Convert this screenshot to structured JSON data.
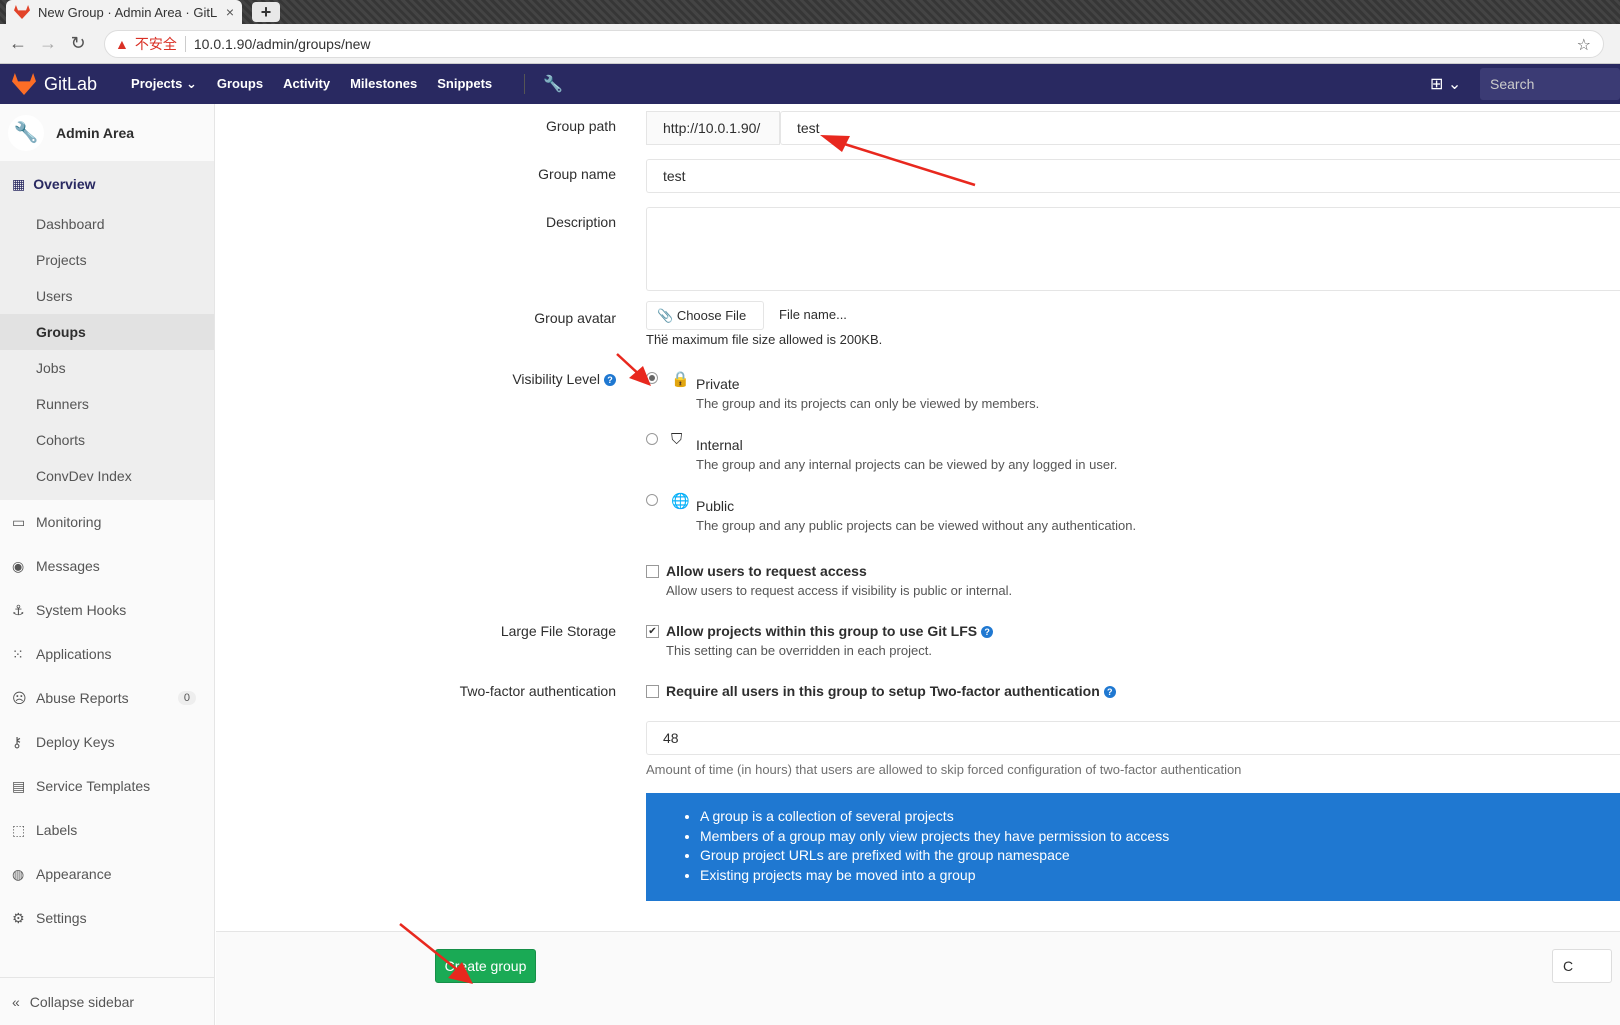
{
  "browser": {
    "tab_title": "New Group · Admin Area · GitL",
    "tab_close": "×",
    "new_tab": "+",
    "insecure_label": "不安全",
    "url": "10.0.1.90/admin/groups/new"
  },
  "topbar": {
    "brand": "GitLab",
    "nav": [
      "Projects",
      "Groups",
      "Activity",
      "Milestones",
      "Snippets"
    ],
    "search_placeholder": "Search"
  },
  "sidebar": {
    "title": "Admin Area",
    "overview": "Overview",
    "overview_items": [
      "Dashboard",
      "Projects",
      "Users",
      "Groups",
      "Jobs",
      "Runners",
      "Cohorts",
      "ConvDev Index"
    ],
    "active_item": "Groups",
    "items": [
      {
        "label": "Monitoring",
        "icon": "monitor-icon"
      },
      {
        "label": "Messages",
        "icon": "broadcast-icon"
      },
      {
        "label": "System Hooks",
        "icon": "anchor-icon"
      },
      {
        "label": "Applications",
        "icon": "grid-icon"
      },
      {
        "label": "Abuse Reports",
        "icon": "face-icon",
        "badge": "0"
      },
      {
        "label": "Deploy Keys",
        "icon": "key-icon"
      },
      {
        "label": "Service Templates",
        "icon": "template-icon"
      },
      {
        "label": "Labels",
        "icon": "label-icon"
      },
      {
        "label": "Appearance",
        "icon": "palette-icon"
      },
      {
        "label": "Settings",
        "icon": "gear-icon"
      }
    ],
    "collapse": "Collapse sidebar"
  },
  "form": {
    "group_path_label": "Group path",
    "group_path_prefix": "http://10.0.1.90/",
    "group_path_value": "test",
    "group_name_label": "Group name",
    "group_name_value": "test",
    "description_label": "Description",
    "avatar_label": "Group avatar",
    "choose_file": "Choose File ...",
    "file_name": "File name...",
    "avatar_help": "The maximum file size allowed is 200KB.",
    "visibility_label": "Visibility Level",
    "visibility": [
      {
        "title": "Private",
        "desc": "The group and its projects can only be viewed by members.",
        "selected": true
      },
      {
        "title": "Internal",
        "desc": "The group and any internal projects can be viewed by any logged in user.",
        "selected": false
      },
      {
        "title": "Public",
        "desc": "The group and any public projects can be viewed without any authentication.",
        "selected": false
      }
    ],
    "request_access_title": "Allow users to request access",
    "request_access_desc": "Allow users to request access if visibility is public or internal.",
    "lfs_label": "Large File Storage",
    "lfs_title": "Allow projects within this group to use Git LFS",
    "lfs_desc": "This setting can be overridden in each project.",
    "tfa_label": "Two-factor authentication",
    "tfa_title": "Require all users in this group to setup Two-factor authentication",
    "grace_value": "48",
    "grace_help": "Amount of time (in hours) that users are allowed to skip forced configuration of two-factor authentication",
    "info": [
      "A group is a collection of several projects",
      "Members of a group may only view projects they have permission to access",
      "Group project URLs are prefixed with the group namespace",
      "Existing projects may be moved into a group"
    ],
    "create_button": "Create group",
    "cancel_button": "C"
  },
  "colors": {
    "topbar": "#292961",
    "primary": "#1f78d1",
    "success": "#1aaa55",
    "annotation": "#e8281e"
  }
}
